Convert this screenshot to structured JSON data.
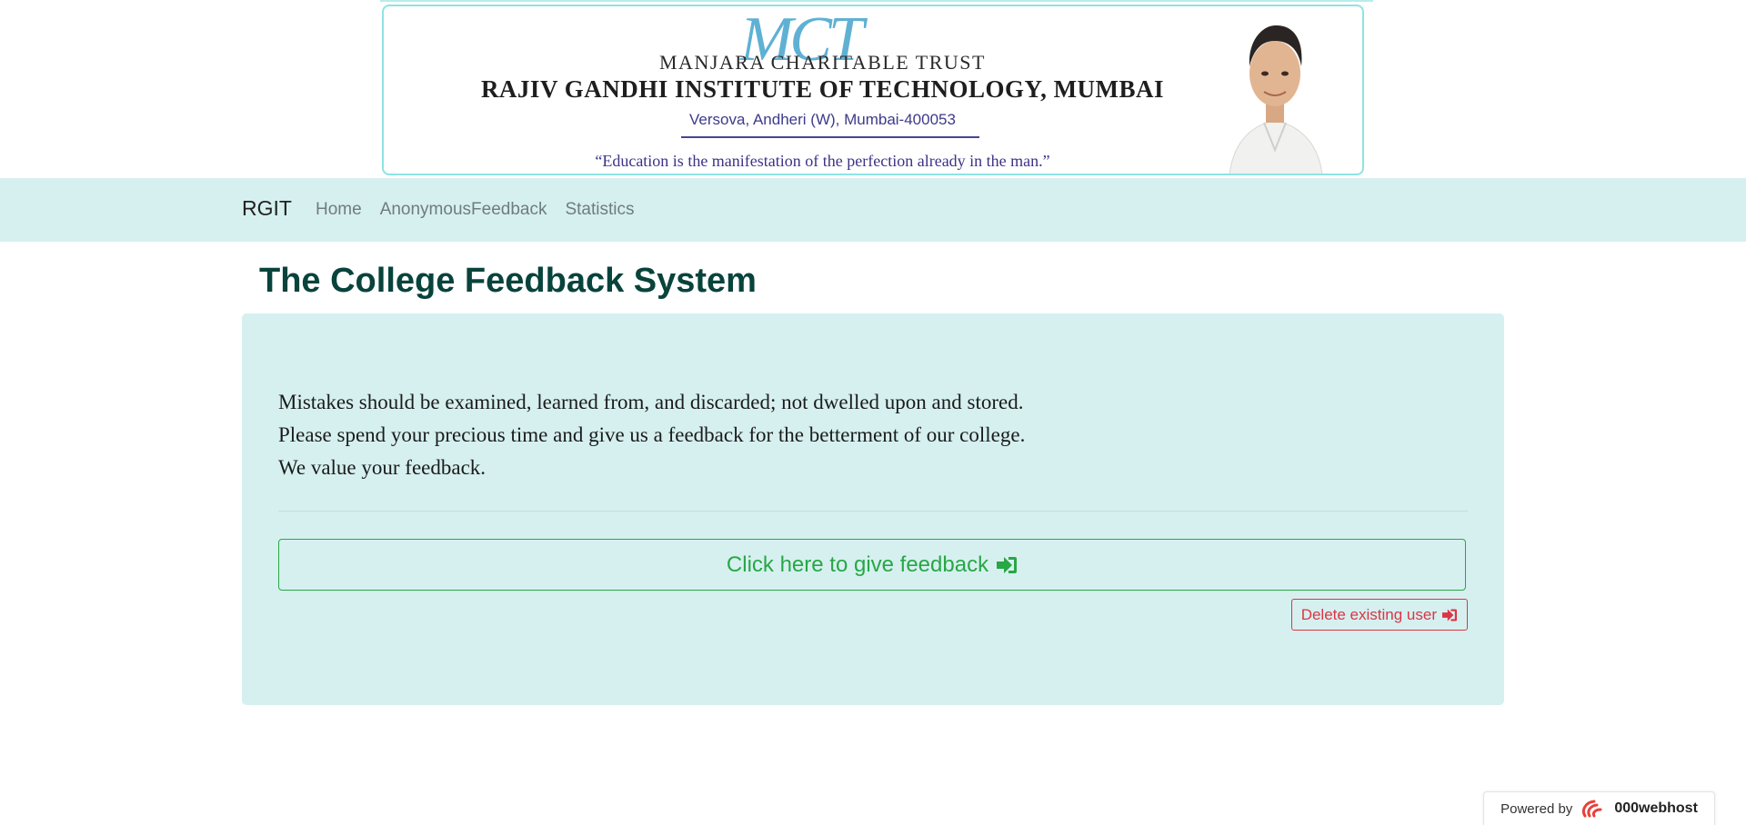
{
  "banner": {
    "mark": "MCT",
    "trust": "MANJARA CHARITABLE TRUST",
    "institute": "RAJIV GANDHI INSTITUTE OF TECHNOLOGY, MUMBAI",
    "address": "Versova, Andheri (W), Mumbai-400053",
    "motto": "“Education is the manifestation of the perfection already in the man.”"
  },
  "navbar": {
    "brand": "RGIT",
    "links": [
      {
        "label": "Home"
      },
      {
        "label": "AnonymousFeedback"
      },
      {
        "label": "Statistics"
      }
    ]
  },
  "page": {
    "title": "The College Feedback System"
  },
  "jumbotron": {
    "lines": [
      "Mistakes should be examined, learned from, and discarded; not dwelled upon and stored.",
      "Please spend your precious time and give us a feedback for the betterment of our college.",
      "We value your feedback."
    ],
    "feedback_button": "Click here to give feedback",
    "delete_button": "Delete existing user",
    "icon": "sign-in-icon"
  },
  "footer": {
    "powered_label": "Powered by",
    "powered_brand": "000webhost"
  },
  "colors": {
    "navbar_bg": "#d6f0f0",
    "title": "#08433c",
    "success": "#28a745",
    "danger": "#dc3545"
  }
}
